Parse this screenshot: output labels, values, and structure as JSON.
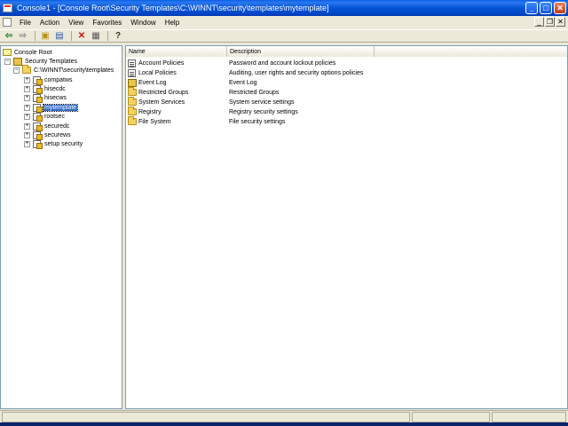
{
  "window": {
    "title": "Console1 - [Console Root\\Security Templates\\C:\\WINNT\\security\\templates\\mytemplate]",
    "buttons": {
      "minimize": "_",
      "maximize": "□",
      "close": "✕"
    }
  },
  "menubar": {
    "items": [
      "File",
      "Action",
      "View",
      "Favorites",
      "Window",
      "Help"
    ],
    "mdi": {
      "minimize": "_",
      "restore": "❐",
      "close": "✕"
    }
  },
  "toolbar": {
    "back": "⇦",
    "forward": "⇨",
    "up": "▣",
    "show_hide": "▤",
    "delete": "✕",
    "export": "▦",
    "help": "?"
  },
  "tree": {
    "root": "Console Root",
    "security_templates": "Security Templates",
    "path": "C:\\WINNT\\security\\templates",
    "expander_plus": "+",
    "expander_minus": "−",
    "templates": [
      "compatws",
      "hisecdc",
      "hisecws",
      "mytemplate",
      "rootsec",
      "securedc",
      "securews",
      "setup security"
    ],
    "selected": "mytemplate"
  },
  "list": {
    "columns": [
      "Name",
      "Description"
    ],
    "rows": [
      {
        "name": "Account Policies",
        "description": "Password and account lockout policies",
        "icon": "policy-icon"
      },
      {
        "name": "Local Policies",
        "description": "Auditing, user rights and security options policies",
        "icon": "policy-icon"
      },
      {
        "name": "Event Log",
        "description": "Event Log",
        "icon": "book-icon"
      },
      {
        "name": "Restricted Groups",
        "description": "Restricted Groups",
        "icon": "folder-icon"
      },
      {
        "name": "System Services",
        "description": "System service settings",
        "icon": "folder-icon"
      },
      {
        "name": "Registry",
        "description": "Registry security settings",
        "icon": "folder-icon"
      },
      {
        "name": "File System",
        "description": "File security settings",
        "icon": "folder-icon"
      }
    ]
  },
  "colors": {
    "title_bar": "#0554d6",
    "selection": "#316ac5",
    "chrome": "#ece9d8"
  }
}
